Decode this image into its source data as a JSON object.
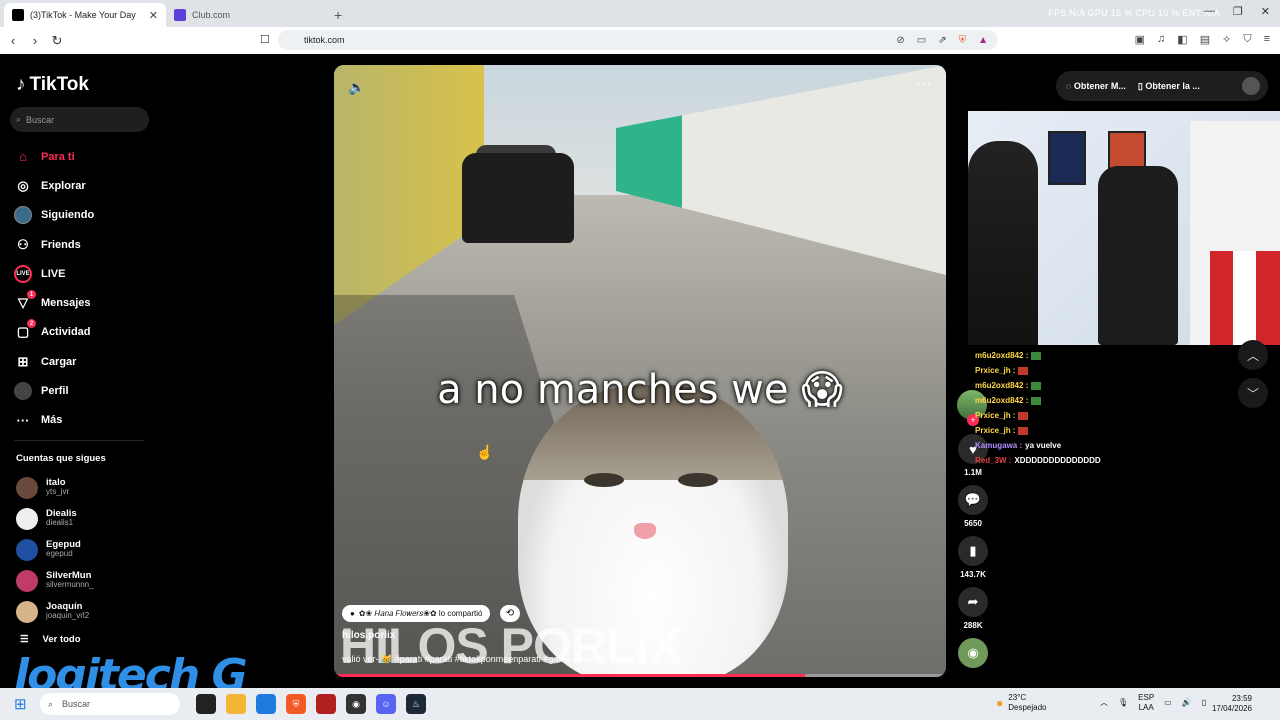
{
  "browser": {
    "tabs": [
      {
        "title": "(3)TikTok - Make Your Day",
        "active": true,
        "favicon_color": "#000000"
      },
      {
        "title": "Club.com",
        "active": false,
        "favicon_color": "#5b3fd6"
      }
    ],
    "address": "tiktok.com",
    "overlay_stats": "FPS  N/A     GPU  15 %     CPU  10 %     ENT  N/A"
  },
  "sidebar": {
    "logo": "TikTok",
    "search_placeholder": "Buscar",
    "nav": [
      {
        "label": "Para ti",
        "icon": "home-icon",
        "active": true
      },
      {
        "label": "Explorar",
        "icon": "compass-icon"
      },
      {
        "label": "Siguiendo",
        "icon": "following-avatar-icon"
      },
      {
        "label": "Friends",
        "icon": "friends-icon"
      },
      {
        "label": "LIVE",
        "icon": "live-icon"
      },
      {
        "label": "Mensajes",
        "icon": "messages-icon",
        "badge": "1"
      },
      {
        "label": "Actividad",
        "icon": "activity-icon",
        "badge": "2"
      },
      {
        "label": "Cargar",
        "icon": "upload-icon"
      },
      {
        "label": "Perfil",
        "icon": "profile-icon"
      },
      {
        "label": "Más",
        "icon": "more-icon"
      }
    ],
    "following_title": "Cuentas que sigues",
    "following": [
      {
        "name": "italo",
        "user": "yts_jvr",
        "color": "#6a4a3a"
      },
      {
        "name": "Diealis",
        "user": "diealis1",
        "color": "#eeeeee"
      },
      {
        "name": "Egepud",
        "user": "egepud",
        "color": "#1e4fa0"
      },
      {
        "name": "SilverMun",
        "user": "silvermunnn_",
        "color": "#c03a6a"
      },
      {
        "name": "Joaquín",
        "user": "joaquin_vrl2",
        "color": "#d8b48a"
      }
    ],
    "see_all": "Ver todo",
    "watermark": "logitech G"
  },
  "video": {
    "caption": "a no manches we 😱",
    "shared_by": "✿❀ 𝐻𝑎𝑛𝑎 𝐹𝑙𝑜𝑤𝑒𝑟𝑠❀✿ lo compartió",
    "overlay_text": "HILOS PORLIX",
    "author": "hilos.porlix",
    "description": "valió ver- 😹 #parati #parati #tiktokponmeenparati #gatos #perros",
    "progress_fraction": 0.77
  },
  "actions": [
    {
      "name": "like",
      "icon": "heart-icon",
      "count": "1.1M"
    },
    {
      "name": "comment",
      "icon": "comment-icon",
      "count": "5650"
    },
    {
      "name": "save",
      "icon": "bookmark-icon",
      "count": "143.7K"
    },
    {
      "name": "share",
      "icon": "share-icon",
      "count": "288K"
    }
  ],
  "top_buttons": {
    "coins": "Obtener M...",
    "app": "Obtener la ..."
  },
  "chat": [
    {
      "user": "m6u2oxd842 :",
      "msg": "",
      "color": "#ffd84a"
    },
    {
      "user": "Prxice_jh :",
      "msg": "",
      "color": "#ffd84a"
    },
    {
      "user": "m6u2oxd842 :",
      "msg": "",
      "color": "#ffd84a"
    },
    {
      "user": "m6u2oxd842 :",
      "msg": "",
      "color": "#ffd84a"
    },
    {
      "user": "Prxice_jh :",
      "msg": "",
      "color": "#ffd84a"
    },
    {
      "user": "Prxice_jh :",
      "msg": "",
      "color": "#ffd84a"
    },
    {
      "user": "Kamugawa :",
      "msg": "ya vuelve",
      "color": "#b38cff"
    },
    {
      "user": "Red_3W :",
      "msg": "XDDDDDDDDDDDDDD",
      "color": "#e04040"
    }
  ],
  "taskbar": {
    "search": "Buscar",
    "weather_temp": "23°C",
    "weather_desc": "Despejado",
    "lang1": "ESP",
    "lang2": "LAA",
    "time": "23:59",
    "date": "17/04/2026"
  }
}
